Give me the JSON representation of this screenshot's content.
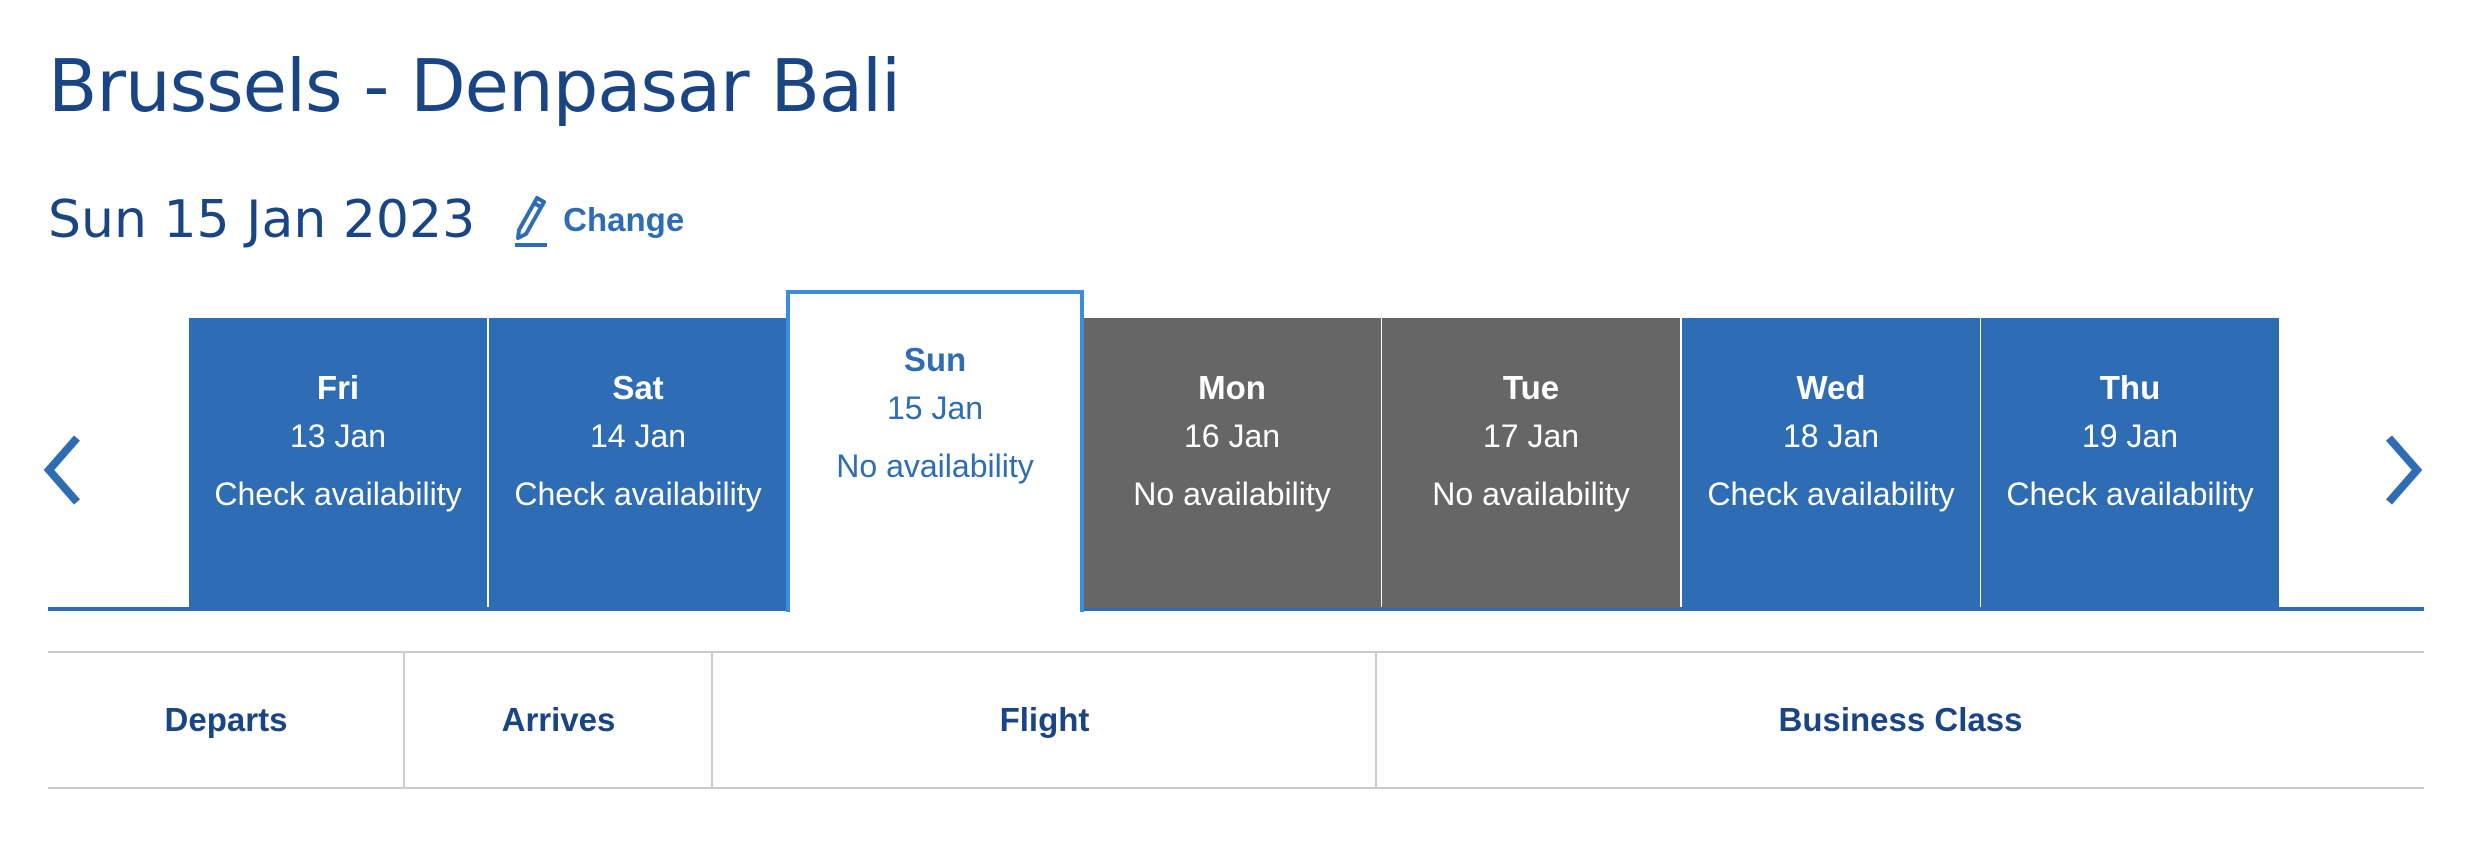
{
  "route": {
    "title": "Brussels - Denpasar Bali"
  },
  "selected_date": {
    "label": "Sun 15 Jan 2023",
    "change_label": "Change",
    "change_icon": "pencil-icon"
  },
  "navigation": {
    "prev_icon": "chevron-left-icon",
    "next_icon": "chevron-right-icon"
  },
  "days": [
    {
      "day": "Fri",
      "date": "13 Jan",
      "status": "Check availability",
      "state": "available"
    },
    {
      "day": "Sat",
      "date": "14 Jan",
      "status": "Check availability",
      "state": "available"
    },
    {
      "day": "Sun",
      "date": "15 Jan",
      "status": "No availability",
      "state": "selected"
    },
    {
      "day": "Mon",
      "date": "16 Jan",
      "status": "No availability",
      "state": "unavailable"
    },
    {
      "day": "Tue",
      "date": "17 Jan",
      "status": "No availability",
      "state": "unavailable"
    },
    {
      "day": "Wed",
      "date": "18 Jan",
      "status": "Check availability",
      "state": "available"
    },
    {
      "day": "Thu",
      "date": "19 Jan",
      "status": "Check availability",
      "state": "available"
    }
  ],
  "results_table": {
    "columns": [
      "Departs",
      "Arrives",
      "Flight",
      "Business Class"
    ]
  },
  "colors": {
    "brand_dark": "#1a4585",
    "brand": "#2e6db4",
    "selected_border": "#3a8ee0",
    "unavailable": "#666666",
    "divider": "#cccccc"
  }
}
